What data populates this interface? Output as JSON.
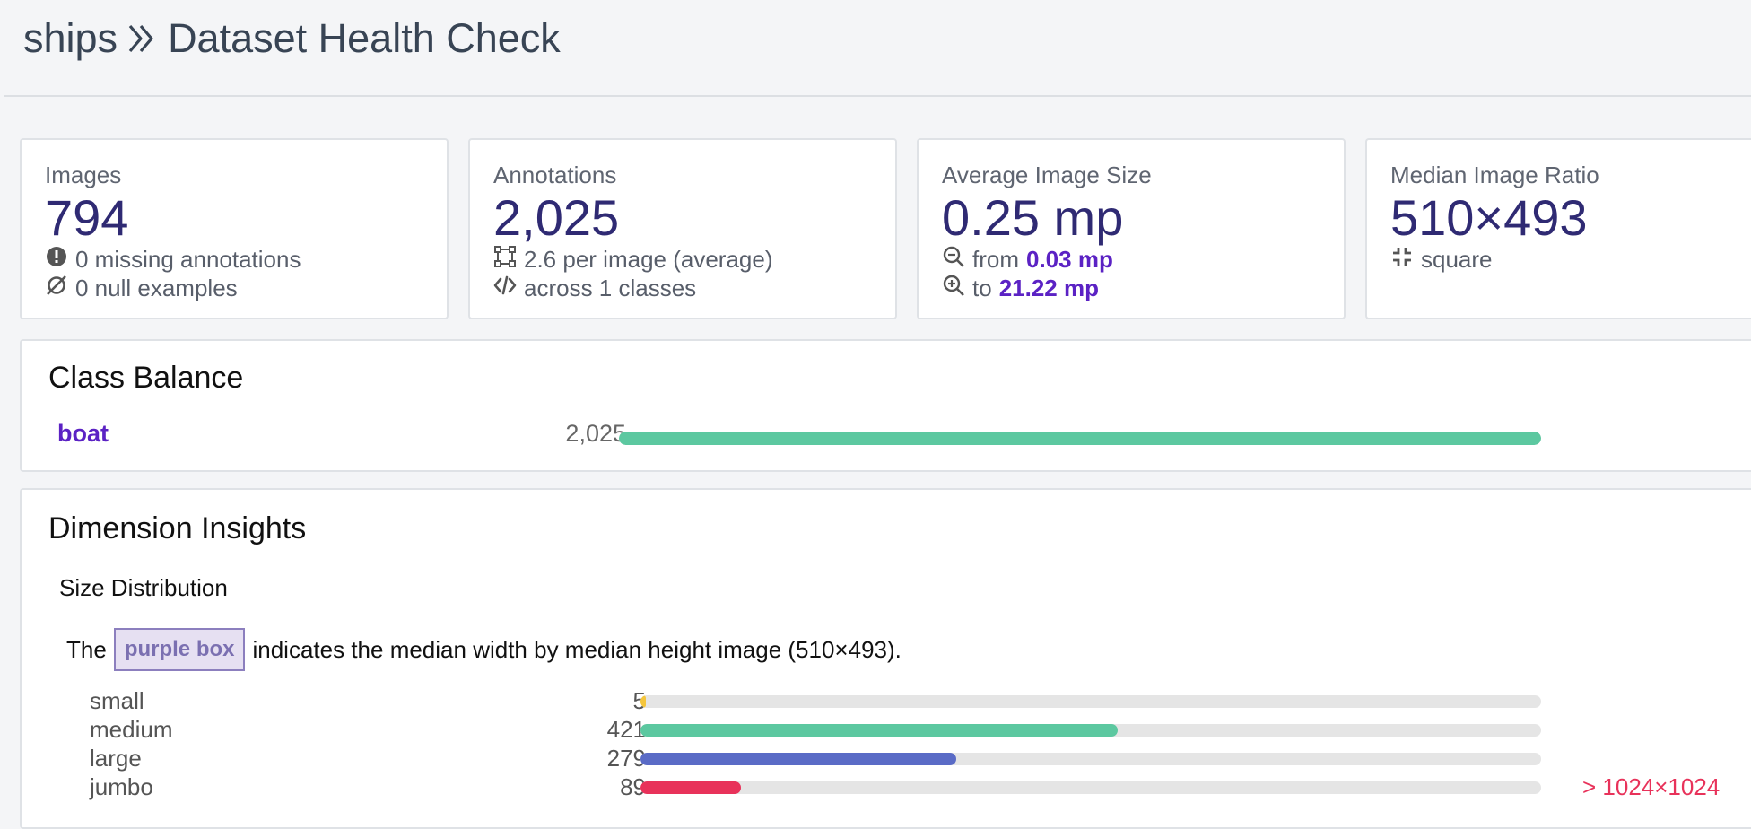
{
  "header": {
    "project": "ships",
    "separator_icon": "double-chevron-right-icon",
    "title": "Dataset Health Check"
  },
  "stats": {
    "images": {
      "label": "Images",
      "value": "794",
      "line1": "0 missing annotations",
      "line2": "0 null examples"
    },
    "annotations": {
      "label": "Annotations",
      "value": "2,025",
      "line1": "2.6 per image (average)",
      "line2": "across 1 classes"
    },
    "avg_size": {
      "label": "Average Image Size",
      "value": "0.25 mp",
      "from_label": "from",
      "from_value": "0.03 mp",
      "to_label": "to",
      "to_value": "21.22 mp"
    },
    "median_ratio": {
      "label": "Median Image Ratio",
      "value": "510×493",
      "line1": "square"
    }
  },
  "class_balance": {
    "title": "Class Balance",
    "rows": [
      {
        "name": "boat",
        "count": "2,025",
        "fraction": 1.0,
        "color": "#5cc8a0"
      }
    ]
  },
  "dimension_insights": {
    "title": "Dimension Insights",
    "subtitle": "Size Distribution",
    "note_pre": "The",
    "note_box": "purple box",
    "note_post": "indicates the median width by median height image (510×493).",
    "rows": [
      {
        "name": "small",
        "count": "5",
        "fraction": 0.006,
        "color": "#f5c63c",
        "note": ""
      },
      {
        "name": "medium",
        "count": "421",
        "fraction": 0.53,
        "color": "#5cc8a0",
        "note": ""
      },
      {
        "name": "large",
        "count": "279",
        "fraction": 0.351,
        "color": "#5a6bc6",
        "note": ""
      },
      {
        "name": "jumbo",
        "count": "89",
        "fraction": 0.112,
        "color": "#e8325a",
        "note": "> 1024×1024"
      }
    ]
  }
}
